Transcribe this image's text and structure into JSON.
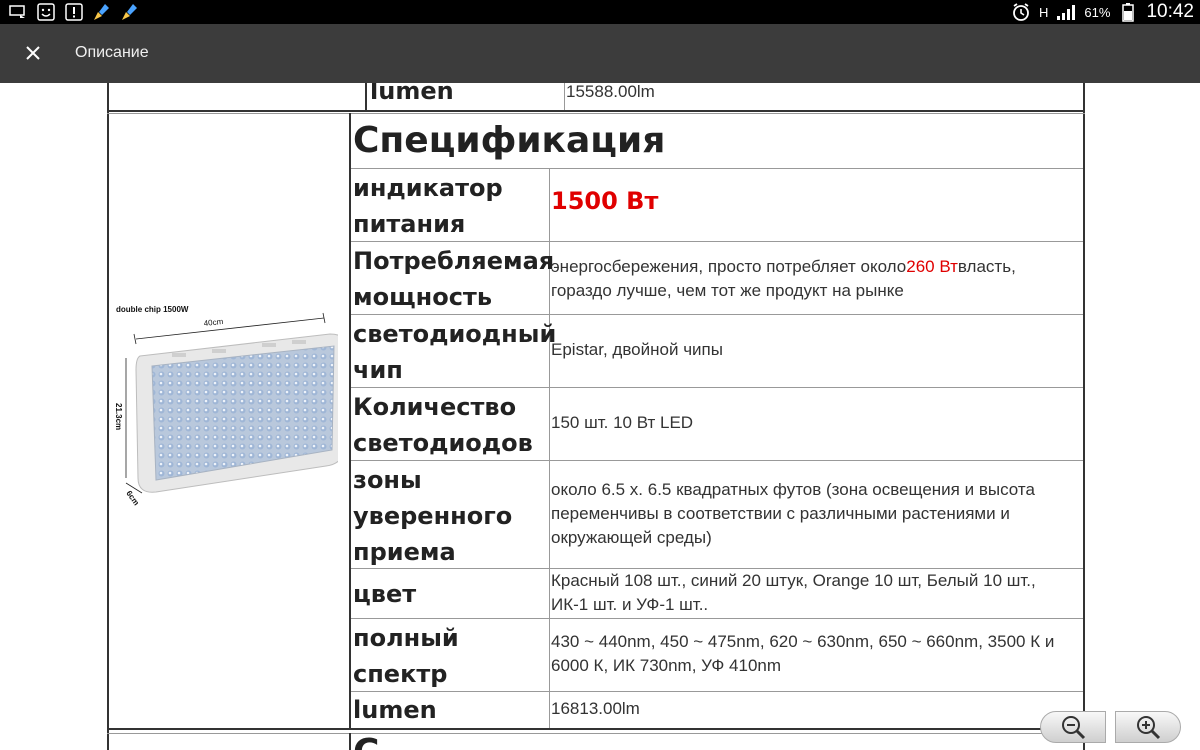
{
  "status_bar": {
    "battery_percent": "61%",
    "time": "10:42",
    "network_label": "H"
  },
  "app_bar": {
    "title": "Описание"
  },
  "rows": {
    "prev_lumen_label": "lumen",
    "prev_lumen_value": "15588.00lm",
    "spec_title": "Спецификация",
    "power_label": "индикатор питания",
    "power_value": "1500 Вт",
    "consumption_label": "Потребляемая мощность",
    "consumption_value_a": "энергосбережения, просто потребляет около",
    "consumption_value_red": "260 Вт",
    "consumption_value_b": "власть, гораздо лучше, чем тот же продукт на рынке",
    "chip_label": "светодиодный чип",
    "chip_value": "Epistar, двойной чипы",
    "count_label": "Количество светодиодов",
    "count_value": "150 шт. 10 Вт LED",
    "zone_label": "зоны уверенного приема",
    "zone_value": "около 6.5 х. 6.5 квадратных футов (зона освещения и высота переменчивы в соответствии с различными растениями и окружающей среды)",
    "color_label": "цвет",
    "color_value": "Красный 108 шт., синий 20 штук, Orange 10 шт, Белый 10 шт., ИК-1 шт. и УФ-1 шт..",
    "spectrum_label": "полный спектр",
    "spectrum_value": "430 ~ 440nm, 450 ~ 475nm, 620 ~ 630nm, 650 ~ 660nm, 3500 К и 6000 К, ИК 730nm, УФ 410nm",
    "lumen_label": "lumen",
    "lumen_value": "16813.00lm",
    "next_title_partial": "С"
  },
  "product_image": {
    "caption": "double chip 1500W",
    "width_label": "40cm",
    "height_label": "21.3cm",
    "depth_label": "6cm"
  }
}
